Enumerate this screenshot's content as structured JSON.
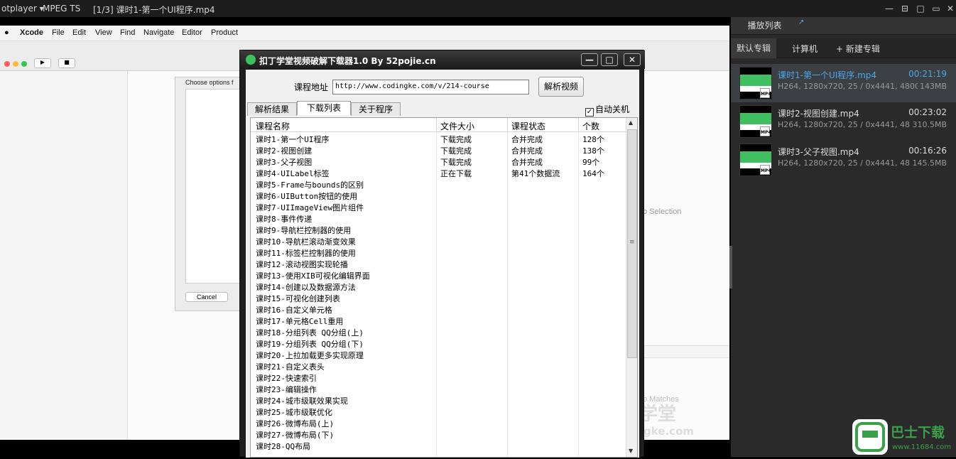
{
  "player": {
    "app_name": "otplayer",
    "format": "MPEG TS",
    "now_playing": "[1/3] 课时1-第一个UI程序.mp4"
  },
  "xcode": {
    "menu": [
      "Xcode",
      "File",
      "Edit",
      "View",
      "Find",
      "Navigate",
      "Editor",
      "Product"
    ],
    "choose_label": "Choose options f",
    "cancel": "Cancel",
    "no_selection": "o Selection",
    "no_matches": "o Matches",
    "watermark": "学堂",
    "watermark2": "gke.com"
  },
  "sidebar": {
    "tab_playlist": "播放列表",
    "subtabs": [
      "默认专辑",
      "计算机",
      "+ 新建专辑"
    ],
    "items": [
      {
        "name": "课时1-第一个UI程序.mp4",
        "duration": "00:21:19",
        "info": "H264, 1280x720, 25 / 0x4441, 48000H...",
        "size": "143MB",
        "badge": "MP4"
      },
      {
        "name": "课时2-视图创建.mp4",
        "duration": "00:23:02",
        "info": "H264, 1280x720, 25 / 0x4441, 48000...",
        "size": "310.5MB",
        "badge": "MP4"
      },
      {
        "name": "课时3-父子视图.mp4",
        "duration": "00:16:26",
        "info": "H264, 1280x720, 25 / 0x4441, 48000...",
        "size": "145.5MB",
        "badge": "MP4"
      }
    ]
  },
  "dialog": {
    "title": "扣丁学堂视频破解下载器1.0 By 52pojie.cn",
    "url_label": "课程地址",
    "url_value": "http://www.codingke.com/v/214-course",
    "parse_button": "解析视频",
    "tabs": [
      "解析结果",
      "下载列表",
      "关于程序"
    ],
    "auto_shutdown": "自动关机",
    "columns": [
      "课程名称",
      "文件大小",
      "课程状态",
      "个数"
    ],
    "rows": [
      [
        "课时1-第一个UI程序",
        "下载完成",
        "合并完成",
        "128个"
      ],
      [
        "课时2-视图创建",
        "下载完成",
        "合并完成",
        "138个"
      ],
      [
        "课时3-父子视图",
        "下载完成",
        "合并完成",
        "99个"
      ],
      [
        "课时4-UILabel标签",
        "正在下载",
        "第41个数据流",
        "164个"
      ],
      [
        "课时5-Frame与bounds的区别",
        "",
        "",
        ""
      ],
      [
        "课时6-UIButton按钮的使用",
        "",
        "",
        ""
      ],
      [
        "课时7-UIImageView图片组件",
        "",
        "",
        ""
      ],
      [
        "课时8-事件传递",
        "",
        "",
        ""
      ],
      [
        "课时9-导航栏控制器的使用",
        "",
        "",
        ""
      ],
      [
        "课时10-导航栏滚动渐变效果",
        "",
        "",
        ""
      ],
      [
        "课时11-标签栏控制器的使用",
        "",
        "",
        ""
      ],
      [
        "课时12-滚动视图实现轮播",
        "",
        "",
        ""
      ],
      [
        "课时13-使用XIB可视化编辑界面",
        "",
        "",
        ""
      ],
      [
        "课时14-创建以及数据源方法",
        "",
        "",
        ""
      ],
      [
        "课时15-可视化创建列表",
        "",
        "",
        ""
      ],
      [
        "课时16-自定义单元格",
        "",
        "",
        ""
      ],
      [
        "课时17-单元格Cell重用",
        "",
        "",
        ""
      ],
      [
        "课时18-分组列表 QQ分组(上)",
        "",
        "",
        ""
      ],
      [
        "课时19-分组列表 QQ分组(下)",
        "",
        "",
        ""
      ],
      [
        "课时20-上拉加载更多实现原理",
        "",
        "",
        ""
      ],
      [
        "课时21-自定义表头",
        "",
        "",
        ""
      ],
      [
        "课时22-快速索引",
        "",
        "",
        ""
      ],
      [
        "课时23-编辑操作",
        "",
        "",
        ""
      ],
      [
        "课时24-城市级联效果实现",
        "",
        "",
        ""
      ],
      [
        "课时25-城市级联优化",
        "",
        "",
        ""
      ],
      [
        "课时26-微博布局(上)",
        "",
        "",
        ""
      ],
      [
        "课时27-微博布局(下)",
        "",
        "",
        ""
      ],
      [
        "课时28-QQ布局",
        "",
        "",
        ""
      ]
    ]
  },
  "site_logo": {
    "name": "巴士下载",
    "url": "www.11684.com"
  }
}
